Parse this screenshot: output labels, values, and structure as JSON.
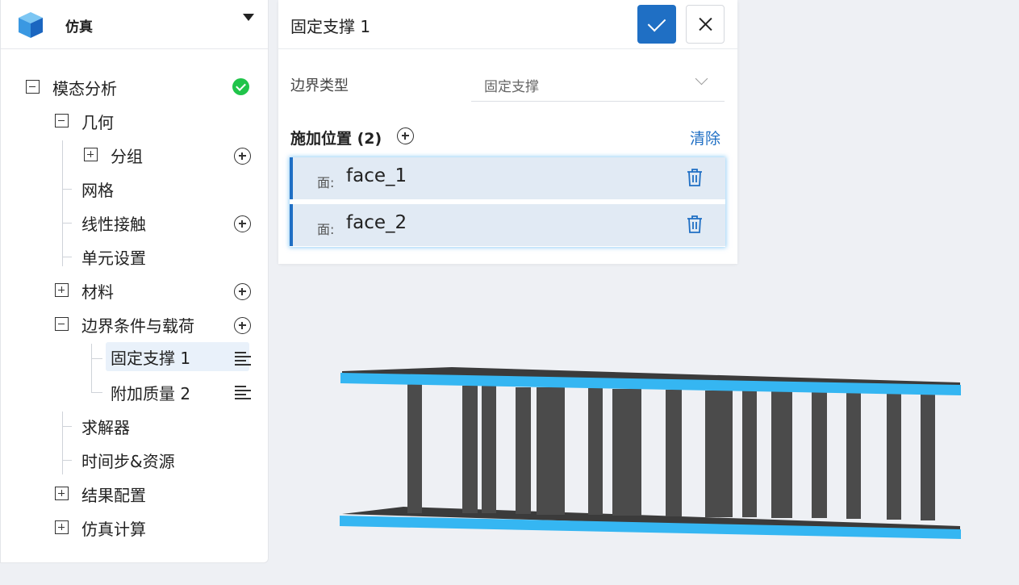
{
  "app": {
    "title": "仿真"
  },
  "tree": {
    "root": "模态分析",
    "geometry": "几何",
    "group": "分组",
    "mesh": "网格",
    "contact": "线性接触",
    "element": "单元设置",
    "material": "材料",
    "bc": "边界条件与载荷",
    "bc_fixed": "固定支撑 1",
    "bc_mass": "附加质量 2",
    "solver": "求解器",
    "timestep": "时间步&资源",
    "result": "结果配置",
    "compute": "仿真计算"
  },
  "editor": {
    "title": "固定支撑 1",
    "boundary_type_label": "边界类型",
    "boundary_type_value": "固定支撑",
    "locations_title": "施加位置 (2)",
    "clear": "清除",
    "locations": [
      {
        "prefix": "面:",
        "name": "face_1"
      },
      {
        "prefix": "面:",
        "name": "face_2"
      }
    ]
  },
  "colors": {
    "accent": "#1f6fc4",
    "success": "#20c44a",
    "face_highlight": "#35b6f2",
    "model_gray": "#4b4b4b"
  },
  "icons": [
    "cube-logo-icon",
    "caret-down-icon",
    "collapse-icon",
    "expand-icon",
    "add-circle-icon",
    "menu-lines-icon",
    "check-circle-icon",
    "check-icon",
    "close-icon",
    "chevron-down-icon",
    "trash-icon"
  ]
}
